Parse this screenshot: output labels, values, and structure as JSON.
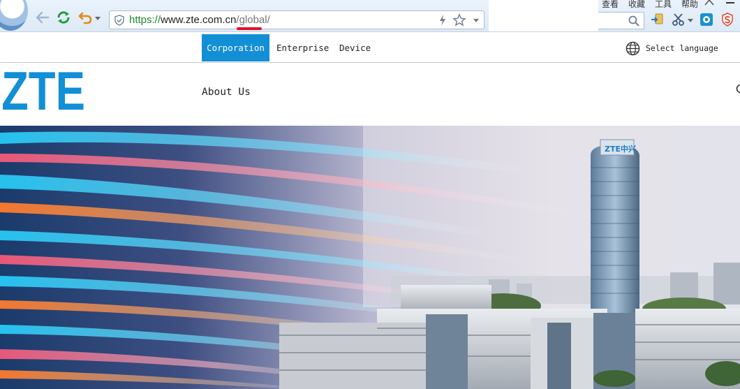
{
  "browser": {
    "url_scheme": "https://",
    "url_host": "www.zte.com.cn",
    "url_path": "/global/",
    "menu": [
      "查看",
      "收藏",
      "工具",
      "帮助"
    ]
  },
  "topnav": {
    "tabs": [
      {
        "label": "Corporation",
        "active": true
      },
      {
        "label": "Enterprise",
        "active": false
      },
      {
        "label": "Device",
        "active": false
      }
    ],
    "language_label": "Select language"
  },
  "header": {
    "logo_text": "ZTE",
    "nav_about": "About Us"
  },
  "hero": {
    "tower_sign": "ZTE中兴"
  },
  "colors": {
    "brand_blue": "#128fd5",
    "url_green": "#1a8a2e",
    "highlight_red": "#e2132c"
  }
}
